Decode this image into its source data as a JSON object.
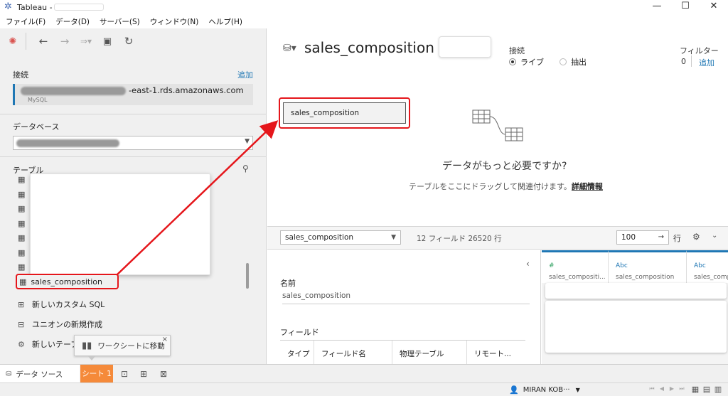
{
  "window": {
    "title": "Tableau -",
    "controls": {
      "minimize": "—",
      "maximize": "☐",
      "close": "✕"
    }
  },
  "menu": [
    "ファイル(F)",
    "データ(D)",
    "サーバー(S)",
    "ウィンドウ(N)",
    "ヘルプ(H)"
  ],
  "toolbar": {
    "icons": [
      "tableau-logo-icon",
      "back-icon",
      "forward-icon",
      "redo-icon",
      "save-icon",
      "refresh-icon"
    ]
  },
  "connections": {
    "label": "接続",
    "add_label": "追加",
    "host_suffix": "-east-1.rds.amazonaws.com",
    "type": "MySQL"
  },
  "database": {
    "label": "データベース"
  },
  "tables": {
    "label": "テーブル",
    "highlighted_table": "sales_composition",
    "options": [
      {
        "icon": "custom-sql-icon",
        "label": "新しいカスタム SQL"
      },
      {
        "icon": "union-icon",
        "label": "ユニオンの新規作成"
      },
      {
        "icon": "table-extension-icon",
        "label": "新しいテーブル"
      }
    ]
  },
  "tooltip": {
    "label": "ワークシートに移動",
    "close": "×"
  },
  "datasource": {
    "title": "sales_composition",
    "connection_label": "接続",
    "live_label": "ライブ",
    "extract_label": "抽出",
    "connection_mode": "live",
    "filter_label": "フィルター",
    "filter_count": "0",
    "filter_add": "追加"
  },
  "canvas": {
    "table_name": "sales_composition",
    "need_more": "データがもっと必要ですか?",
    "drag_hint": "テーブルをここにドラッグして関連付けます。",
    "more_info": "詳細情報"
  },
  "grid_toolbar": {
    "table_select": "sales_composition",
    "fields_rows": "12 フィールド 26520 行",
    "rows_value": "100",
    "rows_label": "行"
  },
  "metadata": {
    "name_label": "名前",
    "name_value": "sales_composition",
    "fields_label": "フィールド",
    "columns": [
      "タイプ",
      "フィールド名",
      "物理テーブル",
      "リモート..."
    ]
  },
  "grid": {
    "columns": [
      {
        "type": "#",
        "type_color": "#2a9d5c",
        "name": "sales_compositi..."
      },
      {
        "type": "Abc",
        "type_color": "#1f77b4",
        "name": "sales_composition"
      },
      {
        "type": "Abc",
        "type_color": "#1f77b4",
        "name": "sales_comp"
      }
    ]
  },
  "bottom_tabs": {
    "datasource_tab": "データ ソース",
    "sheet_tab": "シート 1"
  },
  "status": {
    "user": "MIRAN KOB···"
  },
  "colors": {
    "accent": "#1f77b4",
    "highlight": "#e5161b",
    "sheet_tab": "#f58a3a"
  }
}
